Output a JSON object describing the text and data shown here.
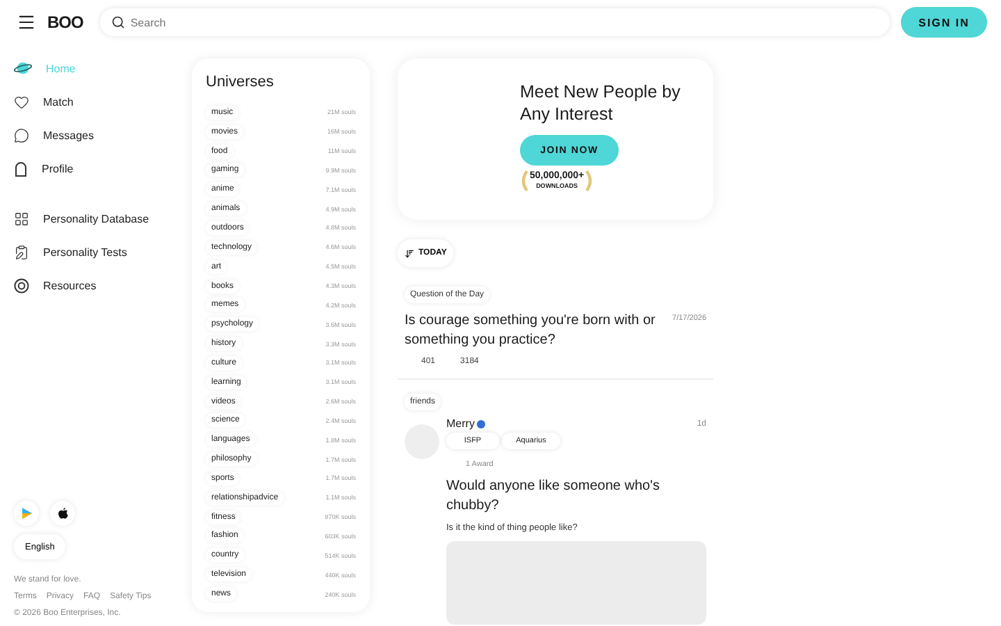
{
  "header": {
    "logo": "BOO",
    "search": {
      "placeholder": "Search"
    },
    "sign_in": "SIGN IN"
  },
  "sidebar": {
    "items": [
      {
        "label": "Home",
        "kind": "home",
        "selected": true
      },
      {
        "label": "Match",
        "kind": "heart",
        "selected": false
      },
      {
        "label": "Messages",
        "kind": "chat",
        "selected": false
      },
      {
        "label": "Profile",
        "kind": "profile",
        "selected": false
      }
    ],
    "secondary_items": [
      {
        "label": "Personality Database",
        "kind": "grid",
        "selected": false
      },
      {
        "label": "Personality Tests",
        "kind": "test",
        "selected": false
      },
      {
        "label": "Resources",
        "kind": "resources",
        "selected": false
      }
    ],
    "language": "English",
    "tagline": "We stand for love.",
    "links": [
      "Terms",
      "Privacy",
      "FAQ",
      "Safety Tips"
    ],
    "copyright": "© 2026 Boo Enterprises, Inc."
  },
  "universes": {
    "title": "Universes",
    "items": [
      {
        "name": "music",
        "count": "21M souls"
      },
      {
        "name": "movies",
        "count": "16M souls"
      },
      {
        "name": "food",
        "count": "11M souls"
      },
      {
        "name": "gaming",
        "count": "9.9M souls"
      },
      {
        "name": "anime",
        "count": "7.1M souls"
      },
      {
        "name": "animals",
        "count": "4.9M souls"
      },
      {
        "name": "outdoors",
        "count": "4.8M souls"
      },
      {
        "name": "technology",
        "count": "4.6M souls"
      },
      {
        "name": "art",
        "count": "4.5M souls"
      },
      {
        "name": "books",
        "count": "4.3M souls"
      },
      {
        "name": "memes",
        "count": "4.2M souls"
      },
      {
        "name": "psychology",
        "count": "3.6M souls"
      },
      {
        "name": "history",
        "count": "3.3M souls"
      },
      {
        "name": "culture",
        "count": "3.1M souls"
      },
      {
        "name": "learning",
        "count": "3.1M souls"
      },
      {
        "name": "videos",
        "count": "2.6M souls"
      },
      {
        "name": "science",
        "count": "2.4M souls"
      },
      {
        "name": "languages",
        "count": "1.8M souls"
      },
      {
        "name": "philosophy",
        "count": "1.7M souls"
      },
      {
        "name": "sports",
        "count": "1.7M souls"
      },
      {
        "name": "relationshipadvice",
        "count": "1.1M souls"
      },
      {
        "name": "fitness",
        "count": "870K souls"
      },
      {
        "name": "fashion",
        "count": "603K souls"
      },
      {
        "name": "country",
        "count": "514K souls"
      },
      {
        "name": "television",
        "count": "440K souls"
      },
      {
        "name": "news",
        "count": "240K souls"
      }
    ]
  },
  "hero": {
    "title": "Meet New People by Any Interest",
    "button": "JOIN NOW",
    "downloads": "50,000,000+",
    "downloads_label": "DOWNLOADS"
  },
  "sort": "TODAY",
  "question": {
    "tag": "Question of the Day",
    "title": "Is courage something you're born with or something you practice?",
    "date": "7/17/2026",
    "stats": [
      "401",
      "3184"
    ]
  },
  "post": {
    "tag": "friends",
    "author": "Merry",
    "verified": true,
    "time": "1d",
    "chips": [
      "ISFP",
      "Aquarius"
    ],
    "awards": "1 Award",
    "title": "Would anyone like someone who's chubby?",
    "body": "Is it the kind of thing people like?"
  }
}
